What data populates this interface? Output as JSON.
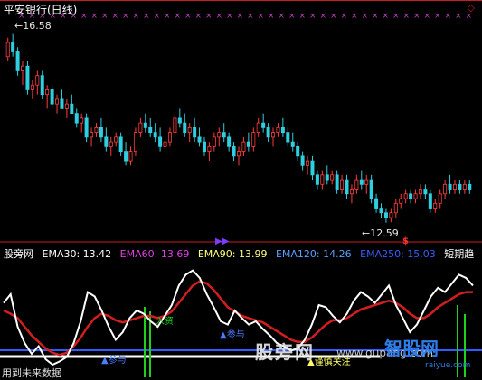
{
  "colors": {
    "background": "#000000",
    "divider": "#c81e1e",
    "up_candle": "#ff3c3c",
    "down_candle": "#2ecfe0",
    "marker": "#c040c0",
    "line_white": "#ffffff",
    "line_red": "#d21e1e",
    "line_blue": "#2f5cff",
    "line_green": "#1dd11d"
  },
  "chart": {
    "title": "平安银行(日线)",
    "high_label": "16.58",
    "low_label": "12.59",
    "corner_glyph": "◇",
    "dollar_mark": "$",
    "arrow_mark": "▶▶",
    "high_arrow": "←",
    "low_arrow": "←"
  },
  "indicator": {
    "name": "股旁网",
    "ema30": "EMA30: 13.42",
    "ema60": "EMA60: 13.69",
    "ema90": "EMA90: 13.99",
    "ema120": "EMA120: 14.26",
    "ema250": "EMA250: 15.03",
    "short_trend": "短期趋",
    "tag_up": "▲参与",
    "tag_up2": "▲参与",
    "tag_careful": "▲谨慎关注",
    "tag_green": "入资"
  },
  "watermarks": {
    "site_cn": "股旁网",
    "site_latin": "www.gupang.com",
    "site_cn2": "智股网",
    "site_url": "raiyue.com",
    "bottom_text": "用到未来数据"
  },
  "chart_data": {
    "type": "candlestick",
    "title": "平安银行(日线)",
    "annotations": [
      {
        "label": "16.58",
        "kind": "high"
      },
      {
        "label": "12.59",
        "kind": "low"
      }
    ],
    "ohlc": [
      [
        16.1,
        16.5,
        16.0,
        16.4
      ],
      [
        16.4,
        16.58,
        16.1,
        16.2
      ],
      [
        16.2,
        16.3,
        15.7,
        15.8
      ],
      [
        15.8,
        16.0,
        15.5,
        15.9
      ],
      [
        15.9,
        16.0,
        15.3,
        15.4
      ],
      [
        15.4,
        15.6,
        15.2,
        15.5
      ],
      [
        15.5,
        15.8,
        15.3,
        15.7
      ],
      [
        15.7,
        15.8,
        15.2,
        15.3
      ],
      [
        15.3,
        15.5,
        15.0,
        15.4
      ],
      [
        15.4,
        15.5,
        15.0,
        15.1
      ],
      [
        15.1,
        15.3,
        14.9,
        15.2
      ],
      [
        15.2,
        15.4,
        15.0,
        15.0
      ],
      [
        15.0,
        15.2,
        14.8,
        15.1
      ],
      [
        15.1,
        15.3,
        14.9,
        14.9
      ],
      [
        14.9,
        15.0,
        14.6,
        14.7
      ],
      [
        14.7,
        14.9,
        14.5,
        14.8
      ],
      [
        14.8,
        14.9,
        14.3,
        14.4
      ],
      [
        14.4,
        14.6,
        14.2,
        14.5
      ],
      [
        14.5,
        14.7,
        14.4,
        14.6
      ],
      [
        14.6,
        14.8,
        14.3,
        14.4
      ],
      [
        14.4,
        14.6,
        14.1,
        14.2
      ],
      [
        14.2,
        14.4,
        14.0,
        14.3
      ],
      [
        14.3,
        14.5,
        14.2,
        14.4
      ],
      [
        14.4,
        14.5,
        14.0,
        14.1
      ],
      [
        14.1,
        14.3,
        13.8,
        13.9
      ],
      [
        13.9,
        14.2,
        13.8,
        14.1
      ],
      [
        14.1,
        14.6,
        14.0,
        14.5
      ],
      [
        14.5,
        14.8,
        14.4,
        14.7
      ],
      [
        14.7,
        14.9,
        14.5,
        14.6
      ],
      [
        14.6,
        14.8,
        14.4,
        14.5
      ],
      [
        14.5,
        14.7,
        14.3,
        14.4
      ],
      [
        14.4,
        14.6,
        14.1,
        14.2
      ],
      [
        14.2,
        14.4,
        14.0,
        14.3
      ],
      [
        14.3,
        14.6,
        14.2,
        14.5
      ],
      [
        14.5,
        14.9,
        14.4,
        14.8
      ],
      [
        14.8,
        15.0,
        14.6,
        14.7
      ],
      [
        14.7,
        14.9,
        14.4,
        14.5
      ],
      [
        14.5,
        14.7,
        14.3,
        14.6
      ],
      [
        14.6,
        14.8,
        14.3,
        14.4
      ],
      [
        14.4,
        14.6,
        14.2,
        14.3
      ],
      [
        14.3,
        14.4,
        14.0,
        14.1
      ],
      [
        14.1,
        14.3,
        13.9,
        14.2
      ],
      [
        14.2,
        14.5,
        14.1,
        14.4
      ],
      [
        14.4,
        14.6,
        14.2,
        14.5
      ],
      [
        14.5,
        14.7,
        14.3,
        14.4
      ],
      [
        14.4,
        14.5,
        14.1,
        14.2
      ],
      [
        14.2,
        14.3,
        13.9,
        14.0
      ],
      [
        14.0,
        14.2,
        13.8,
        14.1
      ],
      [
        14.1,
        14.4,
        14.0,
        14.3
      ],
      [
        14.3,
        14.5,
        14.1,
        14.2
      ],
      [
        14.2,
        14.6,
        14.1,
        14.5
      ],
      [
        14.5,
        14.8,
        14.4,
        14.7
      ],
      [
        14.7,
        14.9,
        14.5,
        14.6
      ],
      [
        14.6,
        14.7,
        14.3,
        14.4
      ],
      [
        14.4,
        14.6,
        14.2,
        14.5
      ],
      [
        14.5,
        14.7,
        14.4,
        14.6
      ],
      [
        14.6,
        14.8,
        14.4,
        14.5
      ],
      [
        14.5,
        14.6,
        14.2,
        14.3
      ],
      [
        14.3,
        14.5,
        14.1,
        14.2
      ],
      [
        14.2,
        14.3,
        13.9,
        14.0
      ],
      [
        14.0,
        14.1,
        13.7,
        13.8
      ],
      [
        13.8,
        14.0,
        13.6,
        13.9
      ],
      [
        13.9,
        14.0,
        13.5,
        13.6
      ],
      [
        13.6,
        13.7,
        13.3,
        13.4
      ],
      [
        13.4,
        13.7,
        13.3,
        13.6
      ],
      [
        13.6,
        13.8,
        13.4,
        13.5
      ],
      [
        13.5,
        13.7,
        13.4,
        13.6
      ],
      [
        13.6,
        13.7,
        13.2,
        13.3
      ],
      [
        13.3,
        13.6,
        13.2,
        13.5
      ],
      [
        13.5,
        13.6,
        13.1,
        13.2
      ],
      [
        13.2,
        13.4,
        13.0,
        13.3
      ],
      [
        13.3,
        13.6,
        13.2,
        13.5
      ],
      [
        13.5,
        13.7,
        13.3,
        13.4
      ],
      [
        13.4,
        13.6,
        13.2,
        13.5
      ],
      [
        13.5,
        13.6,
        13.0,
        13.1
      ],
      [
        13.1,
        13.2,
        12.8,
        12.9
      ],
      [
        12.9,
        13.0,
        12.7,
        12.8
      ],
      [
        12.8,
        12.9,
        12.59,
        12.7
      ],
      [
        12.7,
        12.9,
        12.6,
        12.8
      ],
      [
        12.8,
        13.1,
        12.7,
        13.0
      ],
      [
        13.0,
        13.2,
        12.9,
        13.1
      ],
      [
        13.1,
        13.3,
        13.0,
        13.2
      ],
      [
        13.2,
        13.3,
        13.0,
        13.1
      ],
      [
        13.1,
        13.3,
        13.0,
        13.2
      ],
      [
        13.2,
        13.4,
        13.1,
        13.3
      ],
      [
        13.3,
        13.4,
        13.1,
        13.2
      ],
      [
        13.2,
        13.3,
        12.8,
        12.9
      ],
      [
        12.9,
        13.1,
        12.8,
        13.0
      ],
      [
        13.0,
        13.3,
        12.9,
        13.2
      ],
      [
        13.2,
        13.5,
        13.1,
        13.4
      ],
      [
        13.4,
        13.6,
        13.2,
        13.3
      ],
      [
        13.3,
        13.5,
        13.2,
        13.4
      ],
      [
        13.4,
        13.5,
        13.2,
        13.3
      ],
      [
        13.3,
        13.5,
        13.2,
        13.4
      ],
      [
        13.4,
        13.5,
        13.2,
        13.3
      ]
    ],
    "indicator_series": {
      "white": [
        62,
        70,
        40,
        25,
        15,
        22,
        10,
        5,
        8,
        12,
        25,
        45,
        72,
        68,
        55,
        40,
        28,
        35,
        48,
        55,
        52,
        45,
        40,
        50,
        60,
        78,
        88,
        92,
        85,
        70,
        58,
        45,
        42,
        55,
        48,
        42,
        45,
        38,
        32,
        25,
        22,
        18,
        20,
        28,
        42,
        60,
        58,
        50,
        44,
        52,
        64,
        72,
        68,
        62,
        70,
        78,
        60,
        48,
        35,
        42,
        55,
        68,
        76,
        72,
        80,
        88,
        85,
        78
      ],
      "red": [
        55,
        52,
        48,
        40,
        32,
        26,
        20,
        16,
        14,
        16,
        22,
        30,
        40,
        48,
        52,
        50,
        46,
        44,
        46,
        48,
        50,
        50,
        48,
        50,
        54,
        62,
        70,
        78,
        82,
        80,
        74,
        66,
        58,
        54,
        50,
        48,
        46,
        44,
        40,
        36,
        32,
        28,
        26,
        26,
        30,
        36,
        42,
        46,
        46,
        48,
        52,
        56,
        58,
        60,
        62,
        64,
        62,
        58,
        52,
        48,
        48,
        52,
        58,
        62,
        66,
        70,
        72,
        72
      ]
    }
  }
}
